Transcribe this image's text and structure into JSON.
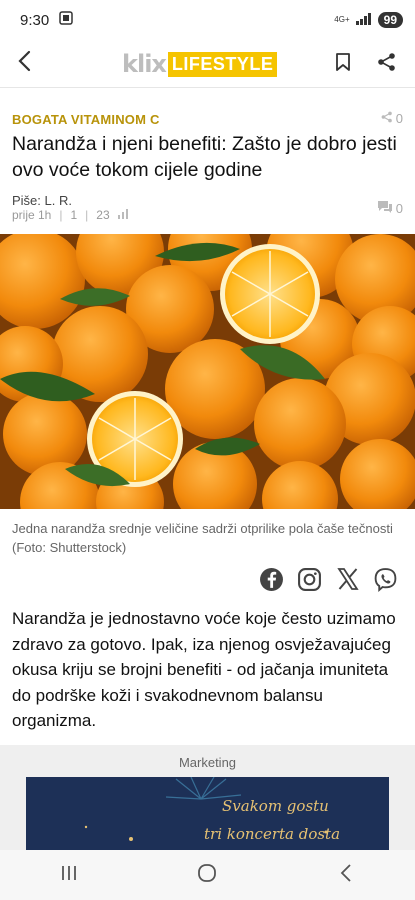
{
  "status": {
    "time": "9:30",
    "network": "4G+",
    "battery": "99"
  },
  "header": {
    "logo_klix": "klix",
    "logo_section": "LIFESTYLE"
  },
  "article": {
    "kicker": "BOGATA VITAMINOM C",
    "share_count": "0",
    "title": "Narandža i njeni benefiti: Zašto je dobro jesti ovo voće tokom cijele godine",
    "author": "Piše: L. R.",
    "time_ago": "prije 1h",
    "meta_count_1": "1",
    "meta_count_2": "23",
    "comment_count": "0",
    "image_caption": "Jedna narandža srednje veličine sadrži otprilike pola čaše tečnosti (Foto: Shutterstock)",
    "lead": "Narandža je jednostavno voće koje često uzimamo zdravo za gotovo. Ipak, iza njenog osvježavajućeg okusa kriju se brojni benefiti - od jačanja imuniteta do podrške koži i svakodnevnom balansu organizma."
  },
  "marketing": {
    "label": "Marketing",
    "ad_line_1": "Svakom gostu",
    "ad_line_2": "tri koncerta dosta"
  },
  "icons": {
    "back": "chevron-left-icon",
    "bookmark": "bookmark-icon",
    "share": "share-icon",
    "facebook": "facebook-icon",
    "instagram": "instagram-icon",
    "x": "x-icon",
    "viber": "viber-icon"
  },
  "colors": {
    "accent": "#f5c400",
    "kicker": "#b8930a",
    "orange": "#f08a10"
  }
}
